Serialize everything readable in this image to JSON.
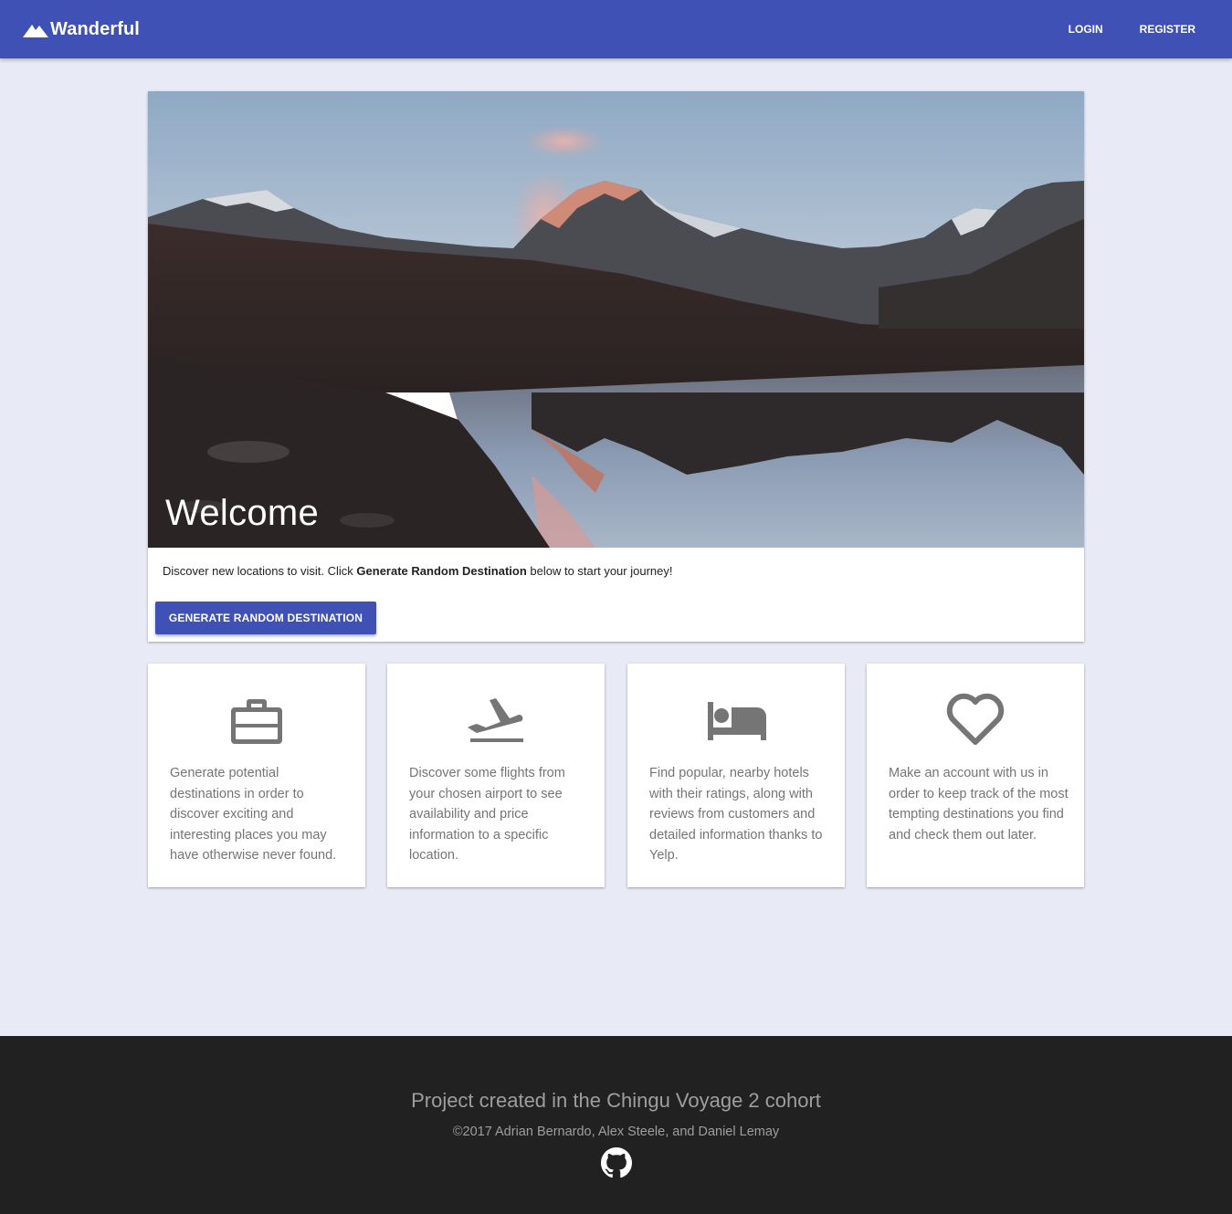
{
  "navbar": {
    "brand": "Wanderful",
    "brand_icon": "mountain-icon",
    "links": [
      "LOGIN",
      "REGISTER"
    ],
    "color": "#3f51b5"
  },
  "hero": {
    "title": "Welcome",
    "text_before": "Discover new locations to visit. Click ",
    "text_bold": "Generate Random Destination",
    "text_after": " below to start your journey!",
    "button_label": "GENERATE RANDOM DESTINATION"
  },
  "features": [
    {
      "icon": "briefcase-icon",
      "text": "Generate potential destinations in order to discover exciting and interesting places you may have otherwise never found."
    },
    {
      "icon": "flight-takeoff-icon",
      "text": "Discover some flights from your chosen airport to see availability and price information to a specific location."
    },
    {
      "icon": "hotel-bed-icon",
      "text": "Find popular, nearby hotels with their ratings, along with reviews from customers and detailed information thanks to Yelp."
    },
    {
      "icon": "heart-outline-icon",
      "text": "Make an account with us in order to keep track of the most tempting destinations you find and check them out later."
    }
  ],
  "footer": {
    "title": "Project created in the Chingu Voyage 2 cohort",
    "credit": "©2017 Adrian Bernardo, Alex Steele, and Daniel Lemay",
    "icon": "github-icon"
  }
}
